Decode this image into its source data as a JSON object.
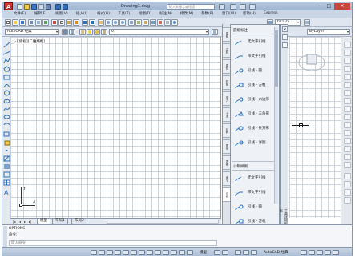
{
  "window": {
    "title": "Drawing1.dwg",
    "search_placeholder": "键入关键字或短语",
    "app_logo_letter": "A"
  },
  "menu": {
    "items": [
      "文件(F)",
      "编辑(E)",
      "视图(V)",
      "插入(I)",
      "格式(O)",
      "工具(T)",
      "绘图(D)",
      "标注(N)",
      "修改(M)",
      "参数(P)",
      "窗口(W)",
      "帮助(H)",
      "Express"
    ]
  },
  "toolbar": {
    "workspace": "AutoCAD 经典",
    "layer": "0",
    "textstyle": "ISO-25",
    "linetype": "ByLayer"
  },
  "viewport": {
    "label": "[-][俯视][二维线框]"
  },
  "ucs": {
    "x_label": "X",
    "y_label": "Y"
  },
  "layout_tabs": {
    "tabs": [
      "模型",
      "布局1",
      "布局2"
    ],
    "active": "模型"
  },
  "palette": {
    "section1": "圆角标注",
    "section2": "公制样例",
    "items1": [
      "无文字引线",
      "带文字引线",
      "引线 - 圆",
      "引线 - 方框",
      "引线 - 六边形",
      "引线 - 三角形",
      "引线 - 长方形",
      "引线 - 详图..."
    ],
    "items2": [
      "无文字引线",
      "带文字引线",
      "引线 - 圆",
      "引线 - 方框"
    ],
    "side_title": "工具选项板 - 所有选项板",
    "tabs": [
      "建模",
      "注释",
      "建筑",
      "机械",
      "电力",
      "土木",
      "结构",
      "图案",
      "表格",
      "命令",
      "引线"
    ]
  },
  "command": {
    "history1": "OPTIONS",
    "history2": "命令:",
    "prompt": "键入命令"
  },
  "statusbar": {
    "model_label": "模型",
    "workspace_label": "AutoCAD 经典"
  },
  "colors": {
    "accent": "#2f6fb7",
    "grid": "#c9d1dc",
    "logo": "#c8271f"
  }
}
